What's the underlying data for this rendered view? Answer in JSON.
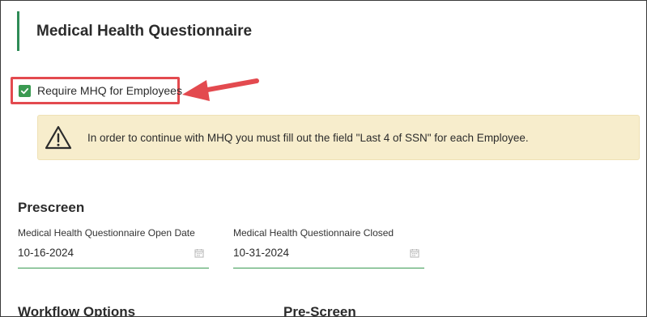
{
  "section": {
    "title": "Medical Health Questionnaire"
  },
  "checkbox": {
    "label": "Require MHQ for Employees",
    "checked": true
  },
  "alert": {
    "icon": "warning-icon",
    "text": "In order to continue with MHQ you must fill out the field \"Last 4 of SSN\" for each Employee."
  },
  "prescreen": {
    "title": "Prescreen",
    "open_date": {
      "label": "Medical Health Questionnaire Open Date",
      "value": "10-16-2024",
      "icon": "calendar-icon"
    },
    "closed_date": {
      "label": "Medical Health Questionnaire Closed",
      "value": "10-31-2024",
      "icon": "calendar-icon"
    }
  },
  "bottom": {
    "workflow_title": "Workflow Options",
    "prescreen_title": "Pre-Screen"
  },
  "colors": {
    "accent": "#2e8b57",
    "checkbox": "#3a9a52",
    "highlight": "#e34a4f",
    "alert_bg": "#f7edcc"
  }
}
